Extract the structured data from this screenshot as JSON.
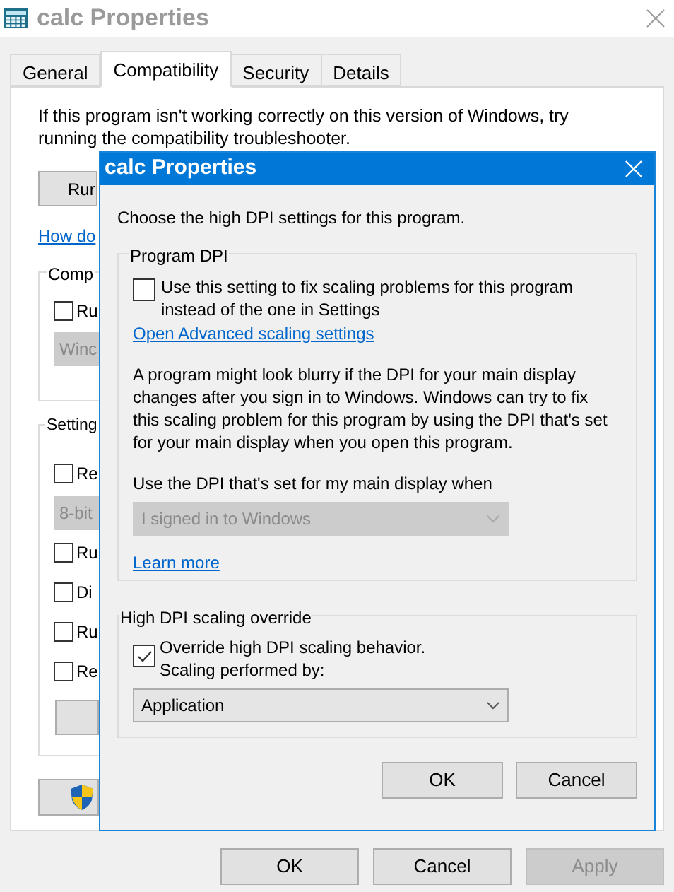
{
  "window": {
    "title": "calc Properties",
    "tabs": [
      {
        "label": "General",
        "selected": false
      },
      {
        "label": "Compatibility",
        "selected": true
      },
      {
        "label": "Security",
        "selected": false
      },
      {
        "label": "Details",
        "selected": false
      }
    ],
    "intro": "If this program isn't working correctly on this version of Windows, try running the compatibility troubleshooter.",
    "troubleshooter_button": "Rur",
    "help_link": "How do",
    "compatibility_mode": {
      "label": "Comp",
      "checkbox": {
        "label": "Ru",
        "checked": false
      },
      "dropdown": {
        "value": "Winc",
        "disabled": true
      }
    },
    "settings": {
      "label": "Setting",
      "items": [
        {
          "kind": "checkbox",
          "label": "Re",
          "checked": false
        },
        {
          "kind": "dropdown",
          "value": "8-bit",
          "disabled": true
        },
        {
          "kind": "checkbox",
          "label": "Ru",
          "checked": false
        },
        {
          "kind": "checkbox",
          "label": "Di",
          "checked": false
        },
        {
          "kind": "checkbox",
          "label": "Ru",
          "checked": false
        },
        {
          "kind": "checkbox",
          "label": "Re",
          "checked": false
        },
        {
          "kind": "button"
        }
      ]
    },
    "buttons": [
      {
        "label": "OK",
        "disabled": false
      },
      {
        "label": "Cancel",
        "disabled": false
      },
      {
        "label": "Apply",
        "disabled": true
      }
    ]
  },
  "dialog": {
    "title": "calc Properties",
    "prompt": "Choose the high DPI settings for this program.",
    "program_dpi": {
      "label": "Program DPI",
      "checkbox": {
        "label": "Use this setting to fix scaling problems for this program instead of the one in Settings",
        "checked": false
      },
      "link": "Open Advanced scaling settings",
      "description": "A program might look blurry if the DPI for your main display changes after you sign in to Windows. Windows can try to fix this scaling problem for this program by using the DPI that's set for your main display when you open this program.",
      "dropdown_label": "Use the DPI that's set for my main display when",
      "dropdown": {
        "value": "I signed in to Windows",
        "disabled": true
      },
      "learn_more": "Learn more"
    },
    "override": {
      "label": "High DPI scaling override",
      "checkbox": {
        "label": "Override high DPI scaling behavior.\nScaling performed by:",
        "checked": true
      },
      "dropdown": {
        "value": "Application",
        "disabled": false
      }
    },
    "buttons": [
      {
        "label": "OK",
        "disabled": false
      },
      {
        "label": "Cancel",
        "disabled": false
      }
    ]
  }
}
